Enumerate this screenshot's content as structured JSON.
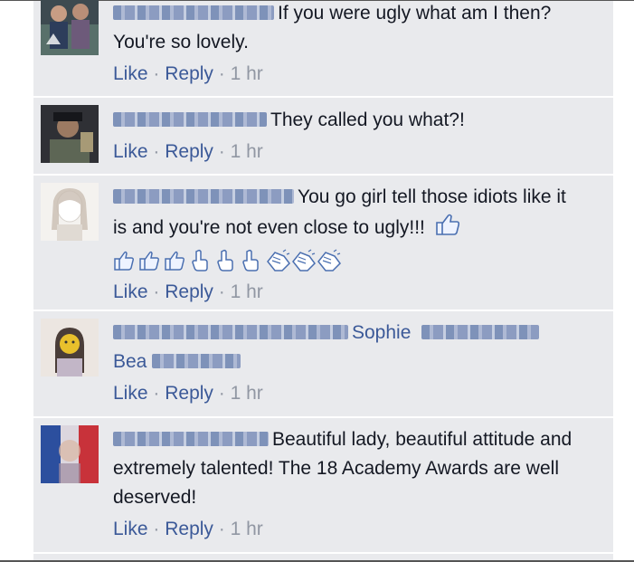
{
  "comments": [
    {
      "text": "If you were ugly what am I then? You're so lovely.",
      "actions": {
        "like": "Like",
        "dot1": "·",
        "reply": "Reply",
        "dot2": "·",
        "time": "1 hr"
      }
    },
    {
      "text": "They called you what?!",
      "actions": {
        "like": "Like",
        "dot1": "·",
        "reply": "Reply",
        "dot2": "·",
        "time": "1 hr"
      }
    },
    {
      "text": "You go girl tell those idiots like it is and you're not even close to ugly!!!",
      "emoticons": [
        "thumbs-up-icon",
        "thumbs-up-icon",
        "thumbs-up-icon",
        "pointing-hand-icon",
        "pointing-hand-icon",
        "pointing-hand-icon",
        "clapping-hands-icon",
        "clapping-hands-icon",
        "clapping-hands-icon"
      ],
      "actions": {
        "like": "Like",
        "dot1": "·",
        "reply": "Reply",
        "dot2": "·",
        "time": "1 hr"
      }
    },
    {
      "tag1": "Sophie",
      "tag2": "Bea",
      "actions": {
        "like": "Like",
        "dot1": "·",
        "reply": "Reply",
        "dot2": "·",
        "time": "1 hr"
      }
    },
    {
      "text": "Beautiful lady, beautiful attitude and extremely talented! The 18 Academy Awards are well deserved!",
      "actions": {
        "like": "Like",
        "dot1": "·",
        "reply": "Reply",
        "dot2": "·",
        "time": "1 hr"
      }
    }
  ],
  "colors": {
    "link": "#3b5998",
    "meta": "#9197a3",
    "panel": "#e9eaed",
    "text": "#141823"
  }
}
